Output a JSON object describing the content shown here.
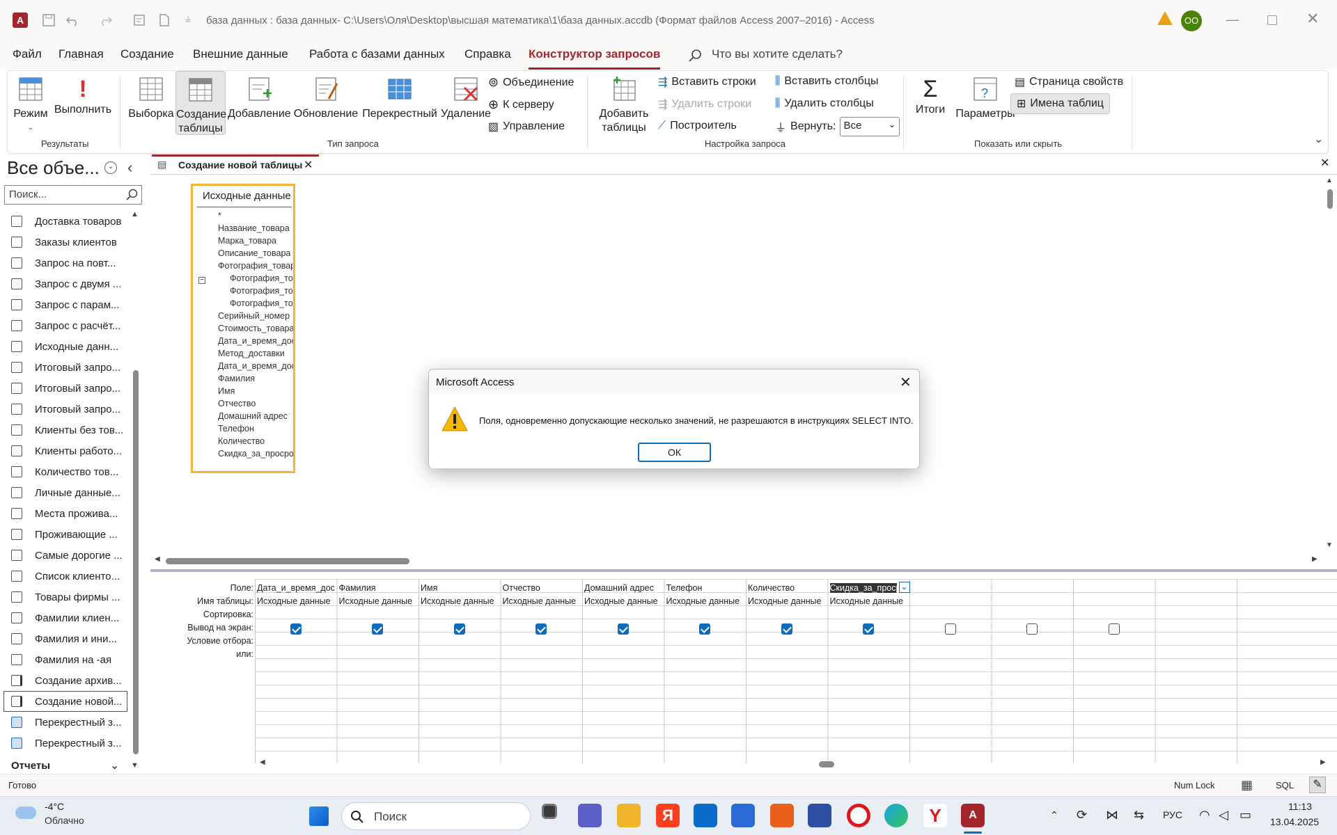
{
  "window": {
    "title": "база данных : база данных- C:\\Users\\Оля\\Desktop\\высшая математика\\1\\база данных.accdb (Формат файлов Access 2007–2016)  -  Access",
    "user_initials": "ОО"
  },
  "tabs": [
    "Файл",
    "Главная",
    "Создание",
    "Внешние данные",
    "Работа с базами данных",
    "Справка",
    "Конструктор запросов"
  ],
  "search_placeholder": "Что вы хотите сделать?",
  "ribbon": {
    "results": {
      "mode": "Режим",
      "run": "Выполнить",
      "group": "Результаты"
    },
    "query_type": {
      "select": "Выборка",
      "make_table_1": "Создание",
      "make_table_2": "таблицы",
      "append": "Добавление",
      "update": "Обновление",
      "crosstab": "Перекрестный",
      "delete": "Удаление",
      "union": "Объединение",
      "server": "К серверу",
      "manage": "Управление",
      "group": "Тип запроса"
    },
    "setup": {
      "add_tables_1": "Добавить",
      "add_tables_2": "таблицы",
      "insert_rows": "Вставить строки",
      "delete_rows": "Удалить строки",
      "builder": "Построитель",
      "insert_cols": "Вставить столбцы",
      "delete_cols": "Удалить столбцы",
      "return_label": "Вернуть:",
      "return_value": "Все",
      "group": "Настройка запроса"
    },
    "show_hide": {
      "totals": "Итоги",
      "params": "Параметры",
      "property_sheet": "Страница свойств",
      "table_names": "Имена таблиц",
      "group": "Показать или скрыть"
    }
  },
  "nav": {
    "title": "Все объе...",
    "search_placeholder": "Поиск...",
    "items": [
      "Доставка товаров",
      "Заказы клиентов",
      "Запрос на повт...",
      "Запрос с двумя ...",
      "Запрос с парам...",
      "Запрос с расчёт...",
      "Исходные данн...",
      "Итоговый запро...",
      "Итоговый запро...",
      "Итоговый запро...",
      "Клиенты без тов...",
      "Клиенты работо...",
      "Количество тов...",
      "Личные данные...",
      "Места прожива...",
      "Проживающие ...",
      "Самые дорогие ...",
      "Список клиенто...",
      "Товары фирмы ...",
      "Фамилии клиен...",
      "Фамилия и ини...",
      "Фамилия на -ая",
      "Создание архив...",
      "Создание новой...",
      "Перекрестный з...",
      "Перекрестный з..."
    ],
    "section_reports": "Отчеты"
  },
  "doc_tab": "Создание новой таблицы",
  "field_list": {
    "title": "Исходные данные",
    "fields": [
      "*",
      "Название_товара",
      "Марка_товара",
      "Описание_товара",
      "Фотография_товара",
      "Фотография_товар",
      "Фотография_товар",
      "Фотография_товар",
      "Серийный_номер",
      "Стоимость_товара",
      "Дата_и_время_достав",
      "Метод_доставки",
      "Дата_и_время_достав",
      "Фамилия",
      "Имя",
      "Отчество",
      "Домашний адрес",
      "Телефон",
      "Количество",
      "Скидка_за_просрочку"
    ]
  },
  "grid": {
    "row_labels": [
      "Поле:",
      "Имя таблицы:",
      "Сортировка:",
      "Вывод на экран:",
      "Условие отбора:",
      "или:"
    ],
    "columns": [
      {
        "field": "Дата_и_время_доставки",
        "table": "Исходные данные",
        "show": true
      },
      {
        "field": "Фамилия",
        "table": "Исходные данные",
        "show": true
      },
      {
        "field": "Имя",
        "table": "Исходные данные",
        "show": true
      },
      {
        "field": "Отчество",
        "table": "Исходные данные",
        "show": true
      },
      {
        "field": "Домашний адрес",
        "table": "Исходные данные",
        "show": true
      },
      {
        "field": "Телефон",
        "table": "Исходные данные",
        "show": true
      },
      {
        "field": "Количество",
        "table": "Исходные данные",
        "show": true
      },
      {
        "field": "Скидка_за_просрочку",
        "table": "Исходные данные",
        "show": true
      },
      {
        "field": "",
        "table": "",
        "show": false
      },
      {
        "field": "",
        "table": "",
        "show": false
      },
      {
        "field": "",
        "table": "",
        "show": false
      }
    ]
  },
  "dialog": {
    "title": "Microsoft Access",
    "message": "Поля, одновременно допускающие несколько значений, не разрешаются в инструкциях SELECT INTO.",
    "ok": "ОК"
  },
  "status": {
    "text": "Готово",
    "numlock": "Num Lock",
    "sql": "SQL"
  },
  "taskbar": {
    "temp": "-4°C",
    "weather": "Облачно",
    "search": "Поиск",
    "lang": "РУС",
    "time": "11:13",
    "date": "13.04.2025"
  },
  "colors": {
    "accent": "#a4262c",
    "checkbox": "#0f6cbd",
    "highlight": "#f5b43a"
  }
}
